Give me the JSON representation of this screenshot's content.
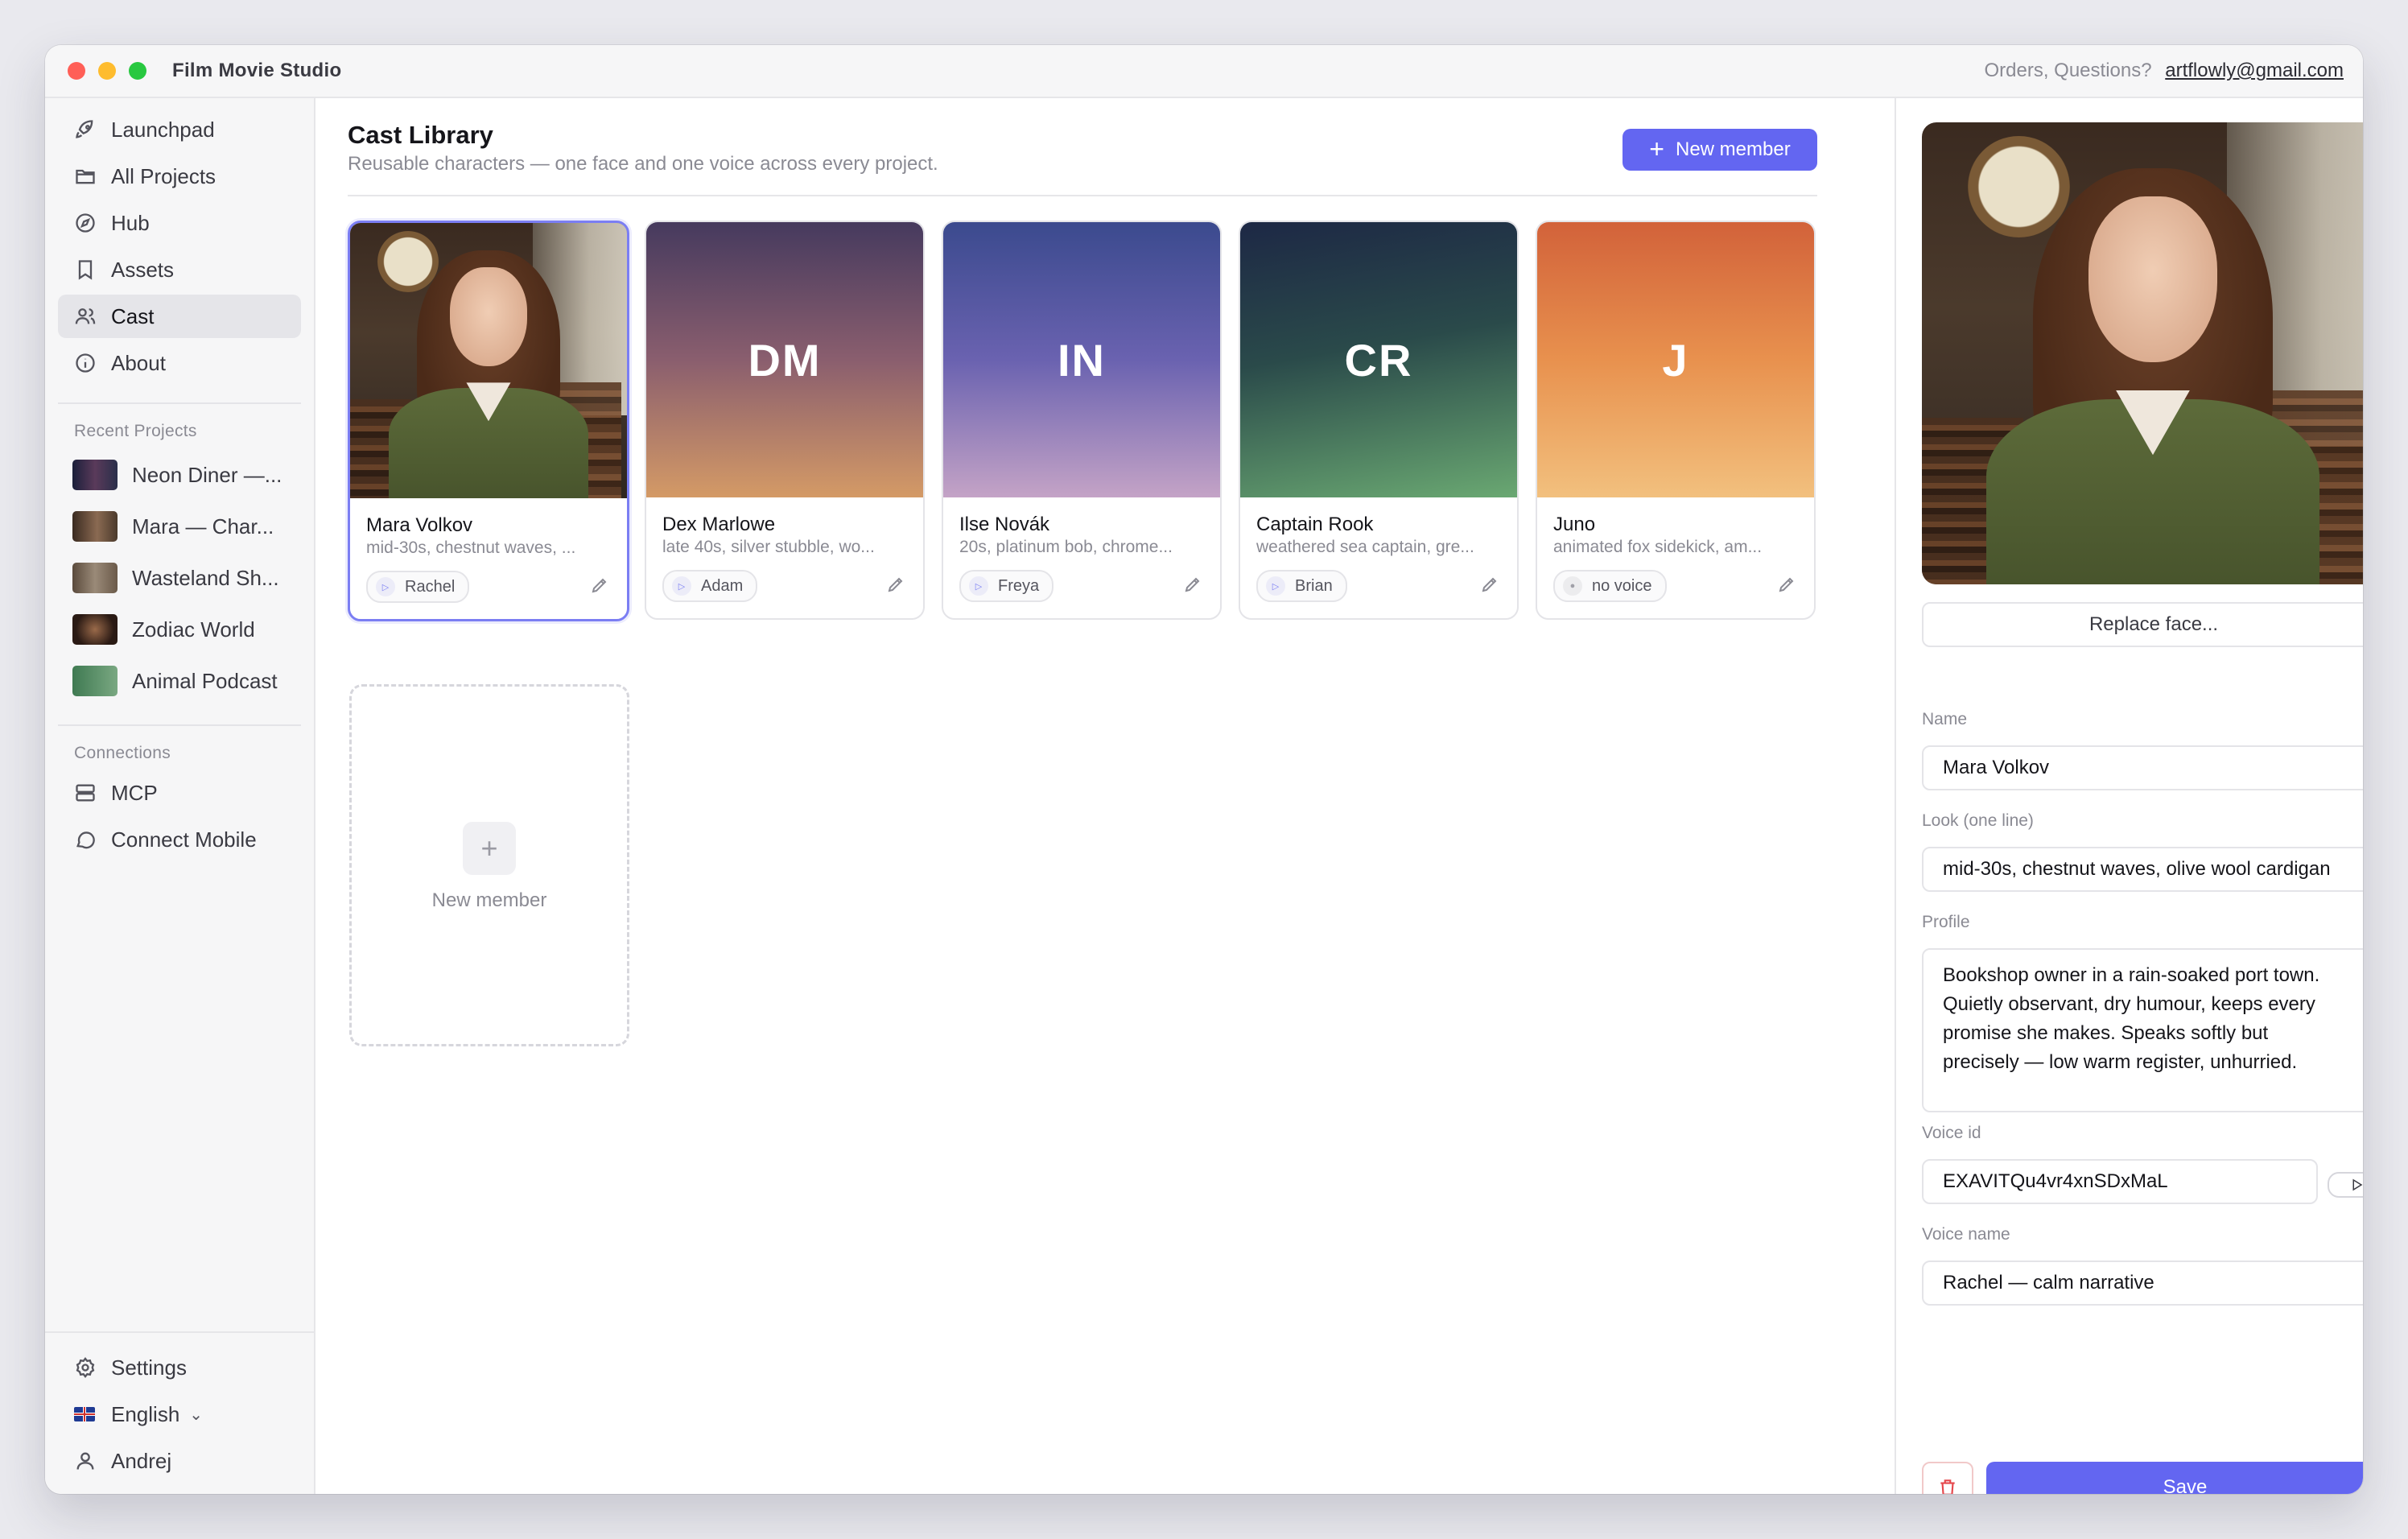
{
  "window": {
    "title": "Film Movie Studio",
    "contact_prefix": "Orders, Questions?",
    "contact_email": "artflowly@gmail.com"
  },
  "sidebar": {
    "nav": [
      {
        "label": "Launchpad",
        "icon": "rocket-icon"
      },
      {
        "label": "All Projects",
        "icon": "folder-icon"
      },
      {
        "label": "Hub",
        "icon": "compass-icon"
      },
      {
        "label": "Assets",
        "icon": "bookmark-icon"
      },
      {
        "label": "Cast",
        "icon": "users-icon",
        "active": true
      },
      {
        "label": "About",
        "icon": "info-icon"
      }
    ],
    "recent_label": "Recent Projects",
    "recent": [
      {
        "label": "Neon Diner —...",
        "thumb_color": "#2a2f4a"
      },
      {
        "label": "Mara — Char...",
        "thumb_color": "#4b3a2c"
      },
      {
        "label": "Wasteland Sh...",
        "thumb_color": "#6b5a4a"
      },
      {
        "label": "Zodiac World",
        "thumb_color": "#3a2a24"
      },
      {
        "label": "Animal Podcast",
        "thumb_color": "#4f8a60"
      }
    ],
    "connections_label": "Connections",
    "connections": [
      {
        "label": "MCP",
        "icon": "server-icon"
      },
      {
        "label": "Connect Mobile",
        "icon": "chat-icon"
      }
    ],
    "bottom": {
      "settings": "Settings",
      "language": "English",
      "user": "Andrej"
    }
  },
  "main": {
    "title": "Cast Library",
    "subtitle": "Reusable characters — one face and one voice across every project.",
    "new_button": "New member",
    "cards": [
      {
        "name": "Mara Volkov",
        "desc": "mid-30s, chestnut waves, ...",
        "voice": "Rachel",
        "initials": "",
        "photo": true,
        "gradient": [
          "#3a2a20",
          "#4b3a2c"
        ]
      },
      {
        "name": "Dex Marlowe",
        "desc": "late 40s, silver stubble, wo...",
        "voice": "Adam",
        "initials": "DM",
        "gradient": [
          "#463a5e",
          "#d49a66"
        ]
      },
      {
        "name": "Ilse Novák",
        "desc": "20s, platinum bob, chrome...",
        "voice": "Freya",
        "initials": "IN",
        "gradient": [
          "#3b4a8e",
          "#c4a3c6"
        ]
      },
      {
        "name": "Captain Rook",
        "desc": "weathered sea captain, gre...",
        "voice": "Brian",
        "initials": "CR",
        "gradient": [
          "#1d2845",
          "#6aa872"
        ]
      },
      {
        "name": "Juno",
        "desc": "animated fox sidekick, am...",
        "voice": "no voice",
        "initials": "J",
        "gradient": [
          "#d2623a",
          "#f2c07e"
        ],
        "no_voice": true
      }
    ],
    "add_card_label": "New member"
  },
  "panel": {
    "replace_button": "Replace face...",
    "name_label": "Name",
    "name_value": "Mara Volkov",
    "look_label": "Look (one line)",
    "look_value": "mid-30s, chestnut waves, olive wool cardigan",
    "profile_label": "Profile",
    "profile_value": "Bookshop owner in a rain-soaked port town.\nQuietly observant, dry humour, keeps every\npromise she makes. Speaks softly but\nprecisely — low warm register, unhurried.",
    "voice_id_label": "Voice id",
    "voice_id_value": "EXAVITQu4vr4xnSDxMaL",
    "voice_name_label": "Voice name",
    "voice_name_value": "Rachel — calm narrative",
    "save_button": "Save"
  },
  "colors": {
    "accent": "#6366f1",
    "danger": "#e5484d"
  }
}
